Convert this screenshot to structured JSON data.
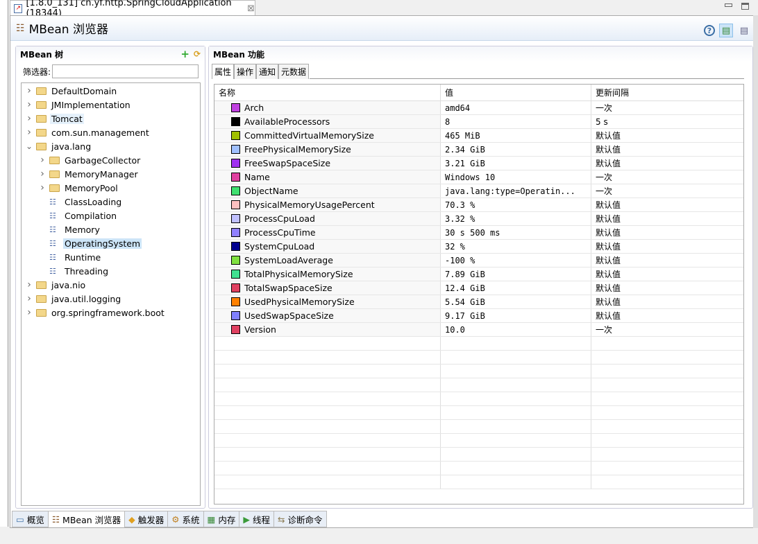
{
  "window": {
    "tab_title": "[1.8.0_131] cn.yf.http.SpringCloudApplication (18344)",
    "close": "⊠"
  },
  "header": {
    "title": "MBean 浏览器",
    "help": "?"
  },
  "tree_panel": {
    "title": "MBean 树",
    "filter_label": "筛选器:",
    "filter_value": "",
    "nodes": [
      {
        "label": "DefaultDomain",
        "level": 0,
        "type": "folder",
        "expanded": false
      },
      {
        "label": "JMImplementation",
        "level": 0,
        "type": "folder",
        "expanded": false
      },
      {
        "label": "Tomcat",
        "level": 0,
        "type": "folder",
        "expanded": false,
        "highlight": true
      },
      {
        "label": "com.sun.management",
        "level": 0,
        "type": "folder",
        "expanded": false
      },
      {
        "label": "java.lang",
        "level": 0,
        "type": "folder",
        "expanded": true
      },
      {
        "label": "GarbageCollector",
        "level": 1,
        "type": "folder",
        "expanded": false
      },
      {
        "label": "MemoryManager",
        "level": 1,
        "type": "folder",
        "expanded": false
      },
      {
        "label": "MemoryPool",
        "level": 1,
        "type": "folder",
        "expanded": false
      },
      {
        "label": "ClassLoading",
        "level": 1,
        "type": "bean"
      },
      {
        "label": "Compilation",
        "level": 1,
        "type": "bean"
      },
      {
        "label": "Memory",
        "level": 1,
        "type": "bean"
      },
      {
        "label": "OperatingSystem",
        "level": 1,
        "type": "bean",
        "selected": true
      },
      {
        "label": "Runtime",
        "level": 1,
        "type": "bean"
      },
      {
        "label": "Threading",
        "level": 1,
        "type": "bean"
      },
      {
        "label": "java.nio",
        "level": 0,
        "type": "folder",
        "expanded": false
      },
      {
        "label": "java.util.logging",
        "level": 0,
        "type": "folder",
        "expanded": false
      },
      {
        "label": "org.springframework.boot",
        "level": 0,
        "type": "folder",
        "expanded": false
      }
    ]
  },
  "feature_panel": {
    "title": "MBean 功能",
    "tabs": [
      "属性",
      "操作",
      "通知",
      "元数据"
    ],
    "active_tab": 0,
    "columns": [
      "名称",
      "值",
      "更新间隔"
    ],
    "rows": [
      {
        "name": "Arch",
        "value": "amd64",
        "interval": "一次",
        "color": "#c040e0"
      },
      {
        "name": "AvailableProcessors",
        "value": "8",
        "interval": "5 s",
        "color": "#000000"
      },
      {
        "name": "CommittedVirtualMemorySize",
        "value": "465 MiB",
        "interval": "默认值",
        "color": "#a0c000"
      },
      {
        "name": "FreePhysicalMemorySize",
        "value": "2.34 GiB",
        "interval": "默认值",
        "color": "#a0c0ff"
      },
      {
        "name": "FreeSwapSpaceSize",
        "value": "3.21 GiB",
        "interval": "默认值",
        "color": "#a030f0"
      },
      {
        "name": "Name",
        "value": "Windows 10",
        "interval": "一次",
        "color": "#e040a0"
      },
      {
        "name": "ObjectName",
        "value": "java.lang:type=Operatin...",
        "interval": "一次",
        "color": "#40e070"
      },
      {
        "name": "PhysicalMemoryUsagePercent",
        "value": "70.3 %",
        "interval": "默认值",
        "color": "#ffc0c0"
      },
      {
        "name": "ProcessCpuLoad",
        "value": "3.32 %",
        "interval": "默认值",
        "color": "#c0c0ff"
      },
      {
        "name": "ProcessCpuTime",
        "value": "30 s 500 ms",
        "interval": "默认值",
        "color": "#9080ff"
      },
      {
        "name": "SystemCpuLoad",
        "value": "32 %",
        "interval": "默认值",
        "color": "#000090"
      },
      {
        "name": "SystemLoadAverage",
        "value": "-100 %",
        "interval": "默认值",
        "color": "#80e040"
      },
      {
        "name": "TotalPhysicalMemorySize",
        "value": "7.89 GiB",
        "interval": "默认值",
        "color": "#40e090"
      },
      {
        "name": "TotalSwapSpaceSize",
        "value": "12.4 GiB",
        "interval": "默认值",
        "color": "#e04060"
      },
      {
        "name": "UsedPhysicalMemorySize",
        "value": "5.54 GiB",
        "interval": "默认值",
        "color": "#ff8000"
      },
      {
        "name": "UsedSwapSpaceSize",
        "value": "9.17 GiB",
        "interval": "默认值",
        "color": "#8080ff"
      },
      {
        "name": "Version",
        "value": "10.0",
        "interval": "一次",
        "color": "#e04060"
      }
    ]
  },
  "bottom_tabs": [
    {
      "label": "概览",
      "icon": "overview-icon"
    },
    {
      "label": "MBean 浏览器",
      "icon": "mbean-icon",
      "active": true
    },
    {
      "label": "触发器",
      "icon": "trigger-icon"
    },
    {
      "label": "系统",
      "icon": "system-icon"
    },
    {
      "label": "内存",
      "icon": "memory-icon"
    },
    {
      "label": "线程",
      "icon": "thread-icon"
    },
    {
      "label": "诊断命令",
      "icon": "diagnostic-icon"
    }
  ]
}
